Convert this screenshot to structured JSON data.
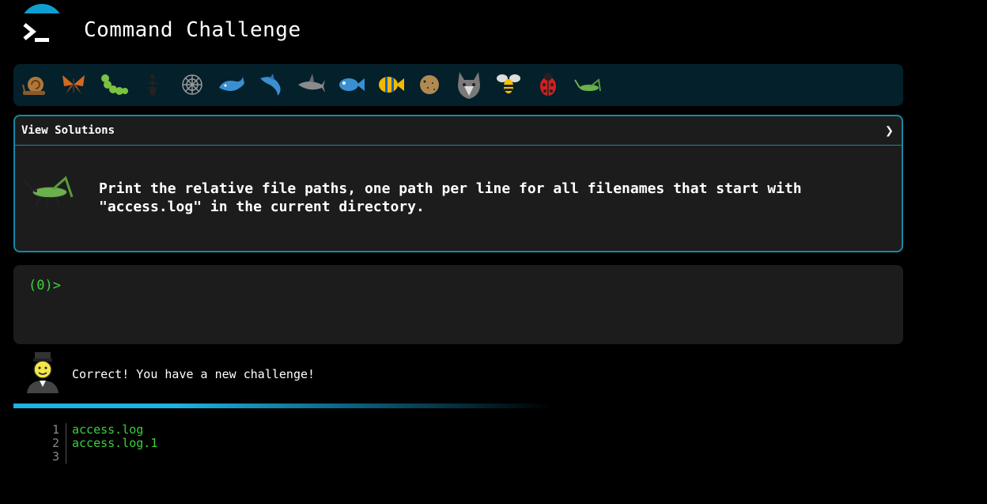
{
  "app": {
    "title": "Command Challenge",
    "logo_icon": "terminal-prompt-icon",
    "accent_color": "#0e9fd0"
  },
  "critters": [
    {
      "name": "snail-icon",
      "color": "#8a5a2b"
    },
    {
      "name": "butterfly-icon",
      "color": "#d2691e"
    },
    {
      "name": "caterpillar-icon",
      "color": "#7cc242"
    },
    {
      "name": "ant-icon",
      "color": "#333333"
    },
    {
      "name": "spider-web-icon",
      "color": "#888888"
    },
    {
      "name": "whale-icon",
      "color": "#3a8fd0"
    },
    {
      "name": "dolphin-icon",
      "color": "#3a8fd0"
    },
    {
      "name": "shark-icon",
      "color": "#8a8a8a"
    },
    {
      "name": "fish-icon",
      "color": "#3a8fd0"
    },
    {
      "name": "tropical-fish-icon",
      "color": "#f2b900"
    },
    {
      "name": "blowfish-icon",
      "color": "#b08a50"
    },
    {
      "name": "wolf-icon",
      "color": "#7a7a7a"
    },
    {
      "name": "bee-icon",
      "color": "#f2c200"
    },
    {
      "name": "ladybug-icon",
      "color": "#d02020"
    },
    {
      "name": "cricket-icon",
      "color": "#6ab04c"
    }
  ],
  "challenge": {
    "view_solutions_label": "View Solutions",
    "expand_icon": "chevron-right-icon",
    "critter_icon": "cricket-icon",
    "text": "Print the relative file paths, one path per line for all filenames that start with\n\"access.log\" in the current directory."
  },
  "terminal": {
    "prompt": "(0)>",
    "input_value": ""
  },
  "feedback": {
    "avatar_icon": "student-avatar-icon",
    "message": "Correct! You have a new challenge!"
  },
  "output": {
    "lines": [
      {
        "number": "1",
        "text": "access.log"
      },
      {
        "number": "2",
        "text": "access.log.1"
      },
      {
        "number": "3",
        "text": ""
      }
    ]
  }
}
